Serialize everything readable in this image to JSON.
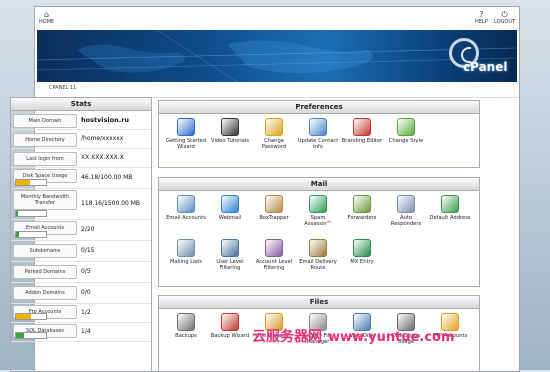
{
  "topbar": {
    "home_label": "HOME",
    "help_label": "HELP",
    "logout_label": "LOGOUT"
  },
  "banner": {
    "logo_text": "cPanel"
  },
  "subbar": {
    "version": "CPANEL 11"
  },
  "stats": {
    "title": "Stats",
    "rows": [
      {
        "label": "Main Domain",
        "value": "hostvision.ru"
      },
      {
        "label": "Home Directory",
        "value": "/home/xxxxxx"
      },
      {
        "label": "Last login from",
        "value": "XX.XXX.XXX.X"
      },
      {
        "label": "Disk Space Usage",
        "value": "46.18/100.00 MB",
        "fill": 0.46,
        "color": "#f0b400"
      },
      {
        "label": "Monthly Bandwidth Transfer",
        "value": "118.16/1500.00 MB",
        "fill": 0.08,
        "color": "#3aa33a"
      },
      {
        "label": "Email Accounts",
        "value": "2/20",
        "fill": 0.1,
        "color": "#3aa33a"
      },
      {
        "label": "Subdomains",
        "value": "0/15"
      },
      {
        "label": "Parked Domains",
        "value": "0/5"
      },
      {
        "label": "Addon Domains",
        "value": "0/0"
      },
      {
        "label": "Ftp Accounts",
        "value": "1/2",
        "fill": 0.5,
        "color": "#f0b400"
      },
      {
        "label": "SQL Databases",
        "value": "1/4",
        "fill": 0.25,
        "color": "#3aa33a"
      }
    ]
  },
  "preferences": {
    "title": "Preferences",
    "items": [
      {
        "label": "Getting Started Wizard",
        "icon": "wizard-icon",
        "color": "#2a6fc9"
      },
      {
        "label": "Video Tutorials",
        "icon": "film-icon",
        "color": "#333333"
      },
      {
        "label": "Change Password",
        "icon": "lock-icon",
        "color": "#d9a21b"
      },
      {
        "label": "Update Contact Info",
        "icon": "contact-icon",
        "color": "#4a86c5"
      },
      {
        "label": "Branding Editor",
        "icon": "palette-icon",
        "color": "#c0392b"
      },
      {
        "label": "Change Style",
        "icon": "style-icon",
        "color": "#5aa83a"
      }
    ]
  },
  "mail": {
    "title": "Mail",
    "items": [
      {
        "label": "Email Accounts",
        "icon": "envelope-icon",
        "color": "#5f8fbf"
      },
      {
        "label": "Webmail",
        "icon": "webmail-icon",
        "color": "#2d7fd0"
      },
      {
        "label": "BoxTrapper",
        "icon": "boxtrapper-icon",
        "color": "#b98a4a"
      },
      {
        "label": "Spam Assassin™",
        "icon": "spam-icon",
        "color": "#2f9b5a"
      },
      {
        "label": "Forwarders",
        "icon": "forward-icon",
        "color": "#6a9a3a"
      },
      {
        "label": "Auto Responders",
        "icon": "autoresponder-icon",
        "color": "#7a8fb0"
      },
      {
        "label": "Default Address",
        "icon": "default-address-icon",
        "color": "#3a9a4a"
      },
      {
        "label": "Mailing Lists",
        "icon": "mailing-list-icon",
        "color": "#6f8faf"
      },
      {
        "label": "User Level Filtering",
        "icon": "filter-icon",
        "color": "#4a6f9a"
      },
      {
        "label": "Account Level Filtering",
        "icon": "account-filter-icon",
        "color": "#8a5aa0"
      },
      {
        "label": "Email Delivery Route",
        "icon": "route-icon",
        "color": "#9a7a3a"
      },
      {
        "label": "MX Entry",
        "icon": "mx-icon",
        "color": "#2a8a4a"
      }
    ]
  },
  "files": {
    "title": "Files",
    "items": [
      {
        "label": "Backups",
        "icon": "backup-icon",
        "color": "#6f6f6f"
      },
      {
        "label": "Backup Wizard",
        "icon": "backup-wizard-icon",
        "color": "#c0392b"
      },
      {
        "label": "File Manager",
        "icon": "file-manager-icon",
        "color": "#d49b2a"
      },
      {
        "label": "Legacy File Manager",
        "icon": "legacy-file-manager-icon",
        "color": "#8a8a8a"
      },
      {
        "label": "Web Disk",
        "icon": "web-disk-icon",
        "color": "#4a7ab0"
      },
      {
        "label": "Disk Space Usage",
        "icon": "disk-usage-icon",
        "color": "#6a6a6a"
      },
      {
        "label": "FTP Accounts",
        "icon": "ftp-icon",
        "color": "#e0a020"
      }
    ]
  },
  "watermark": {
    "cn": "云服务器网",
    "url": "www.yuntue.com"
  }
}
